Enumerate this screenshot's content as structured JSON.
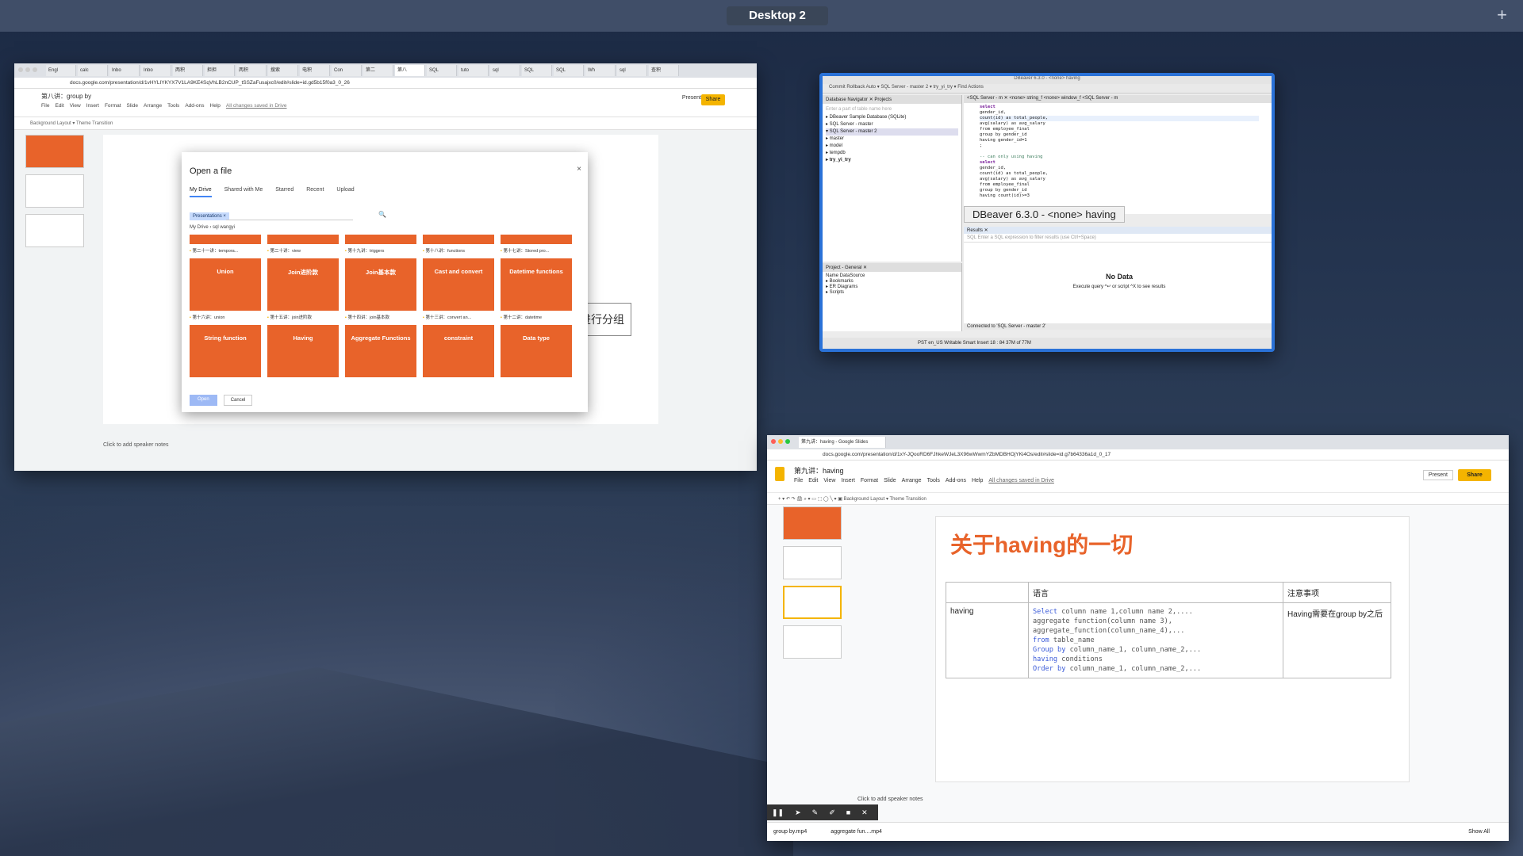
{
  "desktop": {
    "label": "Desktop 2",
    "add": "+"
  },
  "win1": {
    "tabs": [
      "Engl",
      "calc",
      "Inbo",
      "Inbo",
      "两积",
      "担担",
      "两积",
      "搜索",
      "电积",
      "Con",
      "第二",
      "第八",
      "SQL",
      "tuto",
      "sql",
      "SQL",
      "SQL",
      "Wh",
      "sql",
      "查积"
    ],
    "url": "docs.google.com/presentation/d/1vHYLIYKYX7V1LA9KE4SqVhLB2nCUP_tSSZaFusajxc0/edit#slide=id.gd5b15f0a3_0_26",
    "title": "第八讲：group by",
    "menu": [
      "File",
      "Edit",
      "View",
      "Insert",
      "Format",
      "Slide",
      "Arrange",
      "Tools",
      "Add-ons",
      "Help"
    ],
    "saved": "All changes saved in Drive",
    "present": "Present",
    "share": "Share",
    "toolbar": "Background    Layout ▾    Theme    Transition",
    "canvas_text": "进行分组",
    "notes": "Click to add speaker notes",
    "dialog": {
      "title": "Open a file",
      "close": "×",
      "tabs": [
        "My Drive",
        "Shared with Me",
        "Starred",
        "Recent",
        "Upload"
      ],
      "chip": "Presentations ×",
      "search_icon": "🔍",
      "breadcrumb": "My Drive  ›  sql wangyi",
      "row1_labels": [
        "第二十一讲：tempora...",
        "第二十讲：view",
        "第十九讲：triggers",
        "第十八讲：functions",
        "第十七讲：Stored pro..."
      ],
      "row2_cards": [
        "Union",
        "Join进阶款",
        "Join基本款",
        "Cast and convert",
        "Datetime functions"
      ],
      "row2_labels": [
        "第十六讲：union",
        "第十五讲：join进阶款",
        "第十四讲：join基本款",
        "第十三讲：convert an...",
        "第十二讲：datetime"
      ],
      "row3_cards": [
        "String function",
        "Having",
        "Aggregate Functions",
        "constraint",
        "Data type"
      ],
      "open": "Open",
      "cancel": "Cancel"
    }
  },
  "win2": {
    "title": "DBeaver 6.3.0 - <none> having",
    "toolbar": "Commit  Rollback   Auto   ▾   SQL Server - master 2 ▾   try_yi_try ▾    Find Actions",
    "nav_header": "Database Navigator  ✕   Projects",
    "filter": "Enter a part of table name here",
    "tree": [
      "▸ DBeaver Sample Database (SQLite)",
      "▸ SQL Server - master",
      "▾ SQL Server - master 2",
      "    ▸ master",
      "    ▸ model",
      "    ▸ tempdb",
      "    ▸ try_yi_try"
    ],
    "editor_tabs": "<SQL Server - m  ✕   <none> string_f   <none> window_f   <SQL Server - m",
    "code": [
      "select",
      "gender_id,",
      "count(id) as total_people,",
      "avg(salary) as avg_salary",
      "from employee_final",
      "group by gender_id",
      "having gender_id=1",
      ";",
      "",
      "-- can only using having",
      "select",
      "gender_id,",
      "count(id) as total_people,",
      "avg(salary) as avg_salary",
      "from employee_final",
      "group by gender_id",
      "having count(id)>=3"
    ],
    "tooltip": "DBeaver 6.3.0 - <none> having",
    "results_header": "Results  ✕",
    "filter_sql": "SQL  Enter a SQL expression to filter results (use Ctrl+Space)",
    "no_data": "No Data",
    "exec_hint": "Execute query ^↵ or script ^X to see results",
    "project_header": "Project - General  ✕",
    "project_cols": "Name                                  DataSource",
    "project_items": [
      "▸ Bookmarks",
      "▸ ER Diagrams",
      "▸ Scripts"
    ],
    "connected": "Connected to 'SQL Server - master 2'",
    "status": "PST    en_US    Writable         Smart Insert          18 : 84       37M of 77M"
  },
  "win3": {
    "tab": "第九讲：having - Google Slides",
    "url": "docs.google.com/presentation/d/1xY-JQooRD6FJhkeWJeL3X96wWwmYZbMDBHOjYKi4Os/edit#slide=id.g7b64336a1d_0_17",
    "title": "第九讲：having",
    "menu": [
      "File",
      "Edit",
      "View",
      "Insert",
      "Format",
      "Slide",
      "Arrange",
      "Tools",
      "Add-ons",
      "Help"
    ],
    "saved": "All changes saved in Drive",
    "present": "Present",
    "share": "Share",
    "toolbar": "+  ▾  ↶  ↷  🖨  ⌕  ▾    ▭  ⬚  ◯  ╲  ▾  ▣    Background    Layout ▾    Theme    Transition",
    "slide_title": "关于having的一切",
    "table": {
      "headers": [
        "",
        "语言",
        "注意事项"
      ],
      "row_label": "having",
      "note": "Having需要在group by之后",
      "code": [
        [
          "Select",
          " column name 1,column name 2,...."
        ],
        [
          "",
          "aggregate function(column name 3),"
        ],
        [
          "",
          "aggregate_function(column_name_4),..."
        ],
        [
          "from",
          " table_name"
        ],
        [
          "Group by",
          " column_name_1, column_name_2,..."
        ],
        [
          "having",
          " conditions"
        ],
        [
          "Order by",
          " column_name_1, column_name_2,..."
        ]
      ]
    },
    "notes": "Click to add speaker notes",
    "downloads": [
      "group by.mp4",
      "aggregate fun....mp4"
    ],
    "show_all": "Show All"
  }
}
